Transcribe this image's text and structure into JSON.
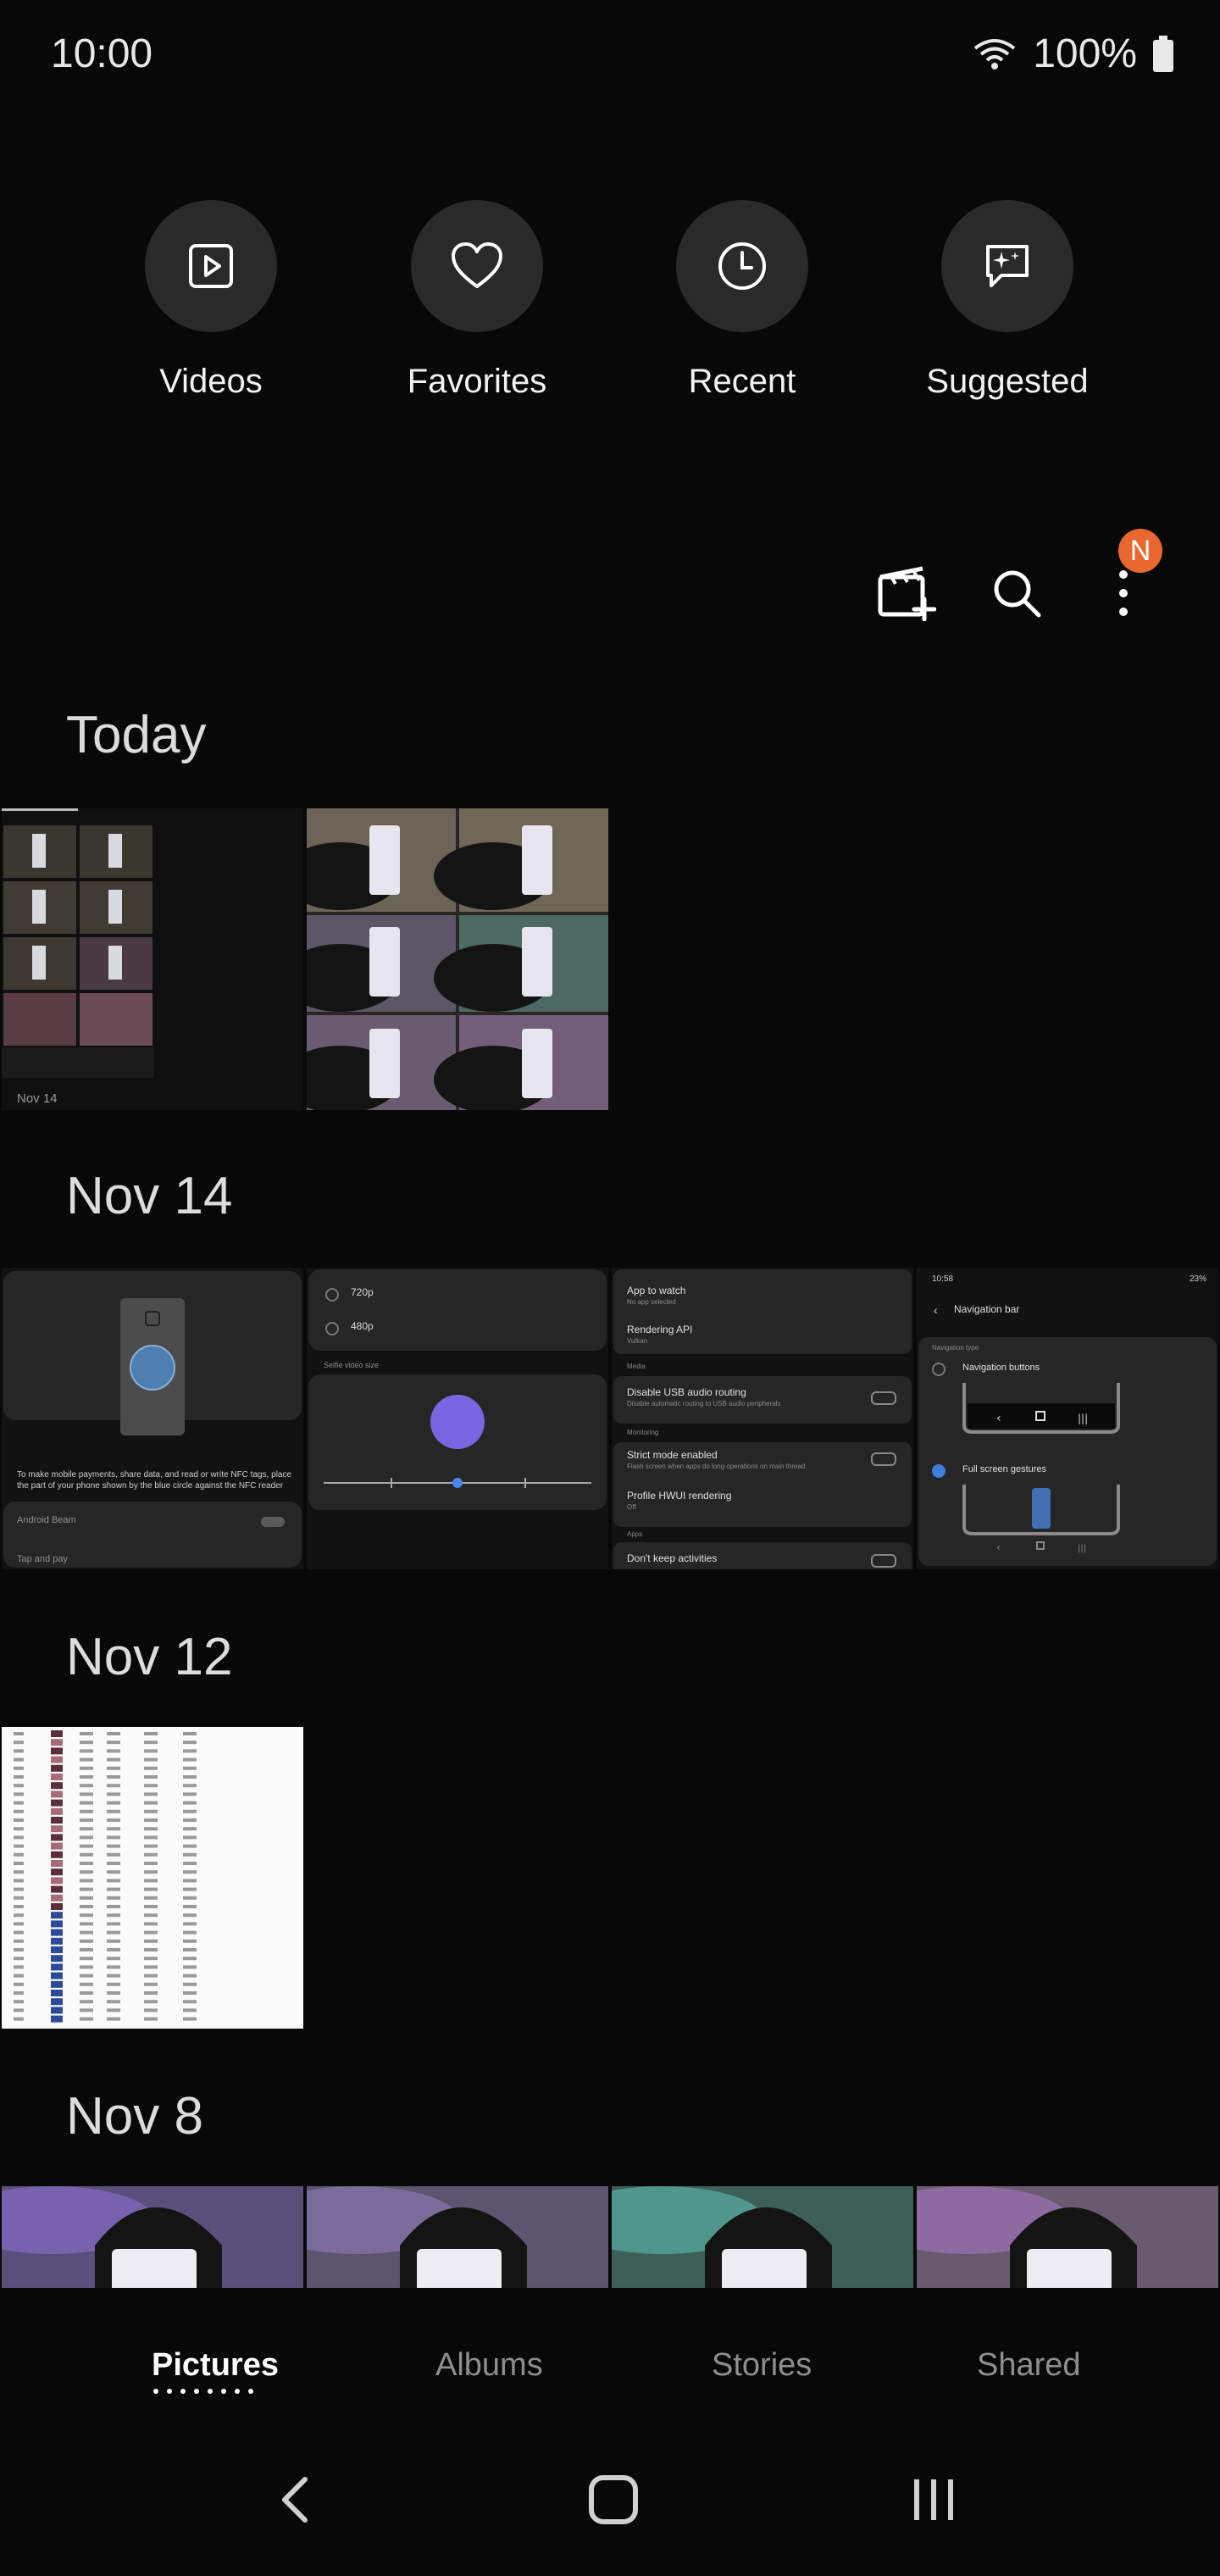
{
  "status": {
    "time": "10:00",
    "battery": "100%"
  },
  "quick_access": [
    {
      "label": "Videos",
      "icon": "play-box-icon"
    },
    {
      "label": "Favorites",
      "icon": "heart-icon"
    },
    {
      "label": "Recent",
      "icon": "clock-icon"
    },
    {
      "label": "Suggested",
      "icon": "sparkle-chat-icon"
    }
  ],
  "toolbar": {
    "badge_letter": "N",
    "badge_color": "#e8682f"
  },
  "sections": [
    {
      "title": "Today",
      "count": 2
    },
    {
      "title": "Nov 14",
      "count": 4
    },
    {
      "title": "Nov 12",
      "count": 1
    },
    {
      "title": "Nov 8",
      "count": 4
    }
  ],
  "thumbs": {
    "today_1_caption": "Nov 14",
    "nov14_1": {
      "nfc_text": "To make mobile payments, share data, and read or write NFC tags, place the part of your phone shown by the blue circle against the NFC reader",
      "android_beam": "Android Beam",
      "tap_pay": "Tap and pay"
    },
    "nov14_2": {
      "opt1": "720p",
      "opt2": "480p",
      "heading": "Selfie video size"
    },
    "nov14_3": {
      "row1": "App to watch",
      "row1_sub": "No app selected",
      "row2": "Rendering API",
      "row2_sub": "Vulkan",
      "h_media": "Media",
      "row3": "Disable USB audio routing",
      "row3_sub": "Disable automatic routing to USB audio peripherals",
      "h_monitoring": "Monitoring",
      "row4": "Strict mode enabled",
      "row4_sub": "Flash screen when apps do long operations on main thread",
      "row5": "Profile HWUI rendering",
      "row5_sub": "Off",
      "h_apps": "Apps",
      "row6": "Don't keep activities"
    },
    "nov14_4": {
      "time": "10:58",
      "battery": "23%",
      "title": "Navigation bar",
      "type_label": "Navigation type",
      "opt1": "Navigation buttons",
      "opt2": "Full screen gestures"
    }
  },
  "tabs": [
    {
      "label": "Pictures",
      "active": true
    },
    {
      "label": "Albums",
      "active": false
    },
    {
      "label": "Stories",
      "active": false
    },
    {
      "label": "Shared",
      "active": false
    }
  ],
  "nav": {
    "back": "back-icon",
    "home": "home-icon",
    "recents": "recents-icon"
  }
}
